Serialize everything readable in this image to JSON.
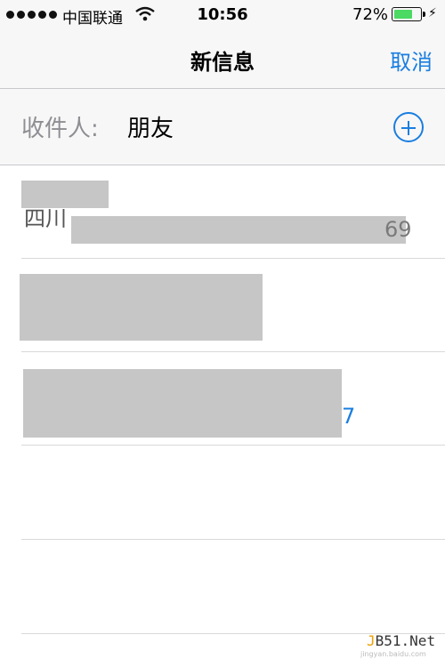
{
  "status_bar": {
    "carrier": "中国联通",
    "time": "10:56",
    "battery": "72%",
    "battery_level": 0.72,
    "icons": [
      "signal-dots-icon",
      "wifi-icon",
      "battery-icon",
      "charging-icon"
    ]
  },
  "nav": {
    "title": "新信息",
    "cancel": "取消"
  },
  "recipient": {
    "label": "收件人:",
    "value": "朋友",
    "add_icon": "add-circle-icon"
  },
  "suggestions": [
    {
      "location": "四川",
      "number_tail": "69"
    },
    {
      "number_tail": ""
    },
    {
      "number_tail": "7"
    }
  ],
  "watermark": {
    "prefix": "J",
    "text": "B51.Net",
    "small": "jingyan.baidu.com"
  },
  "colors": {
    "accent": "#1a7ee0",
    "battery": "#4cd964"
  }
}
